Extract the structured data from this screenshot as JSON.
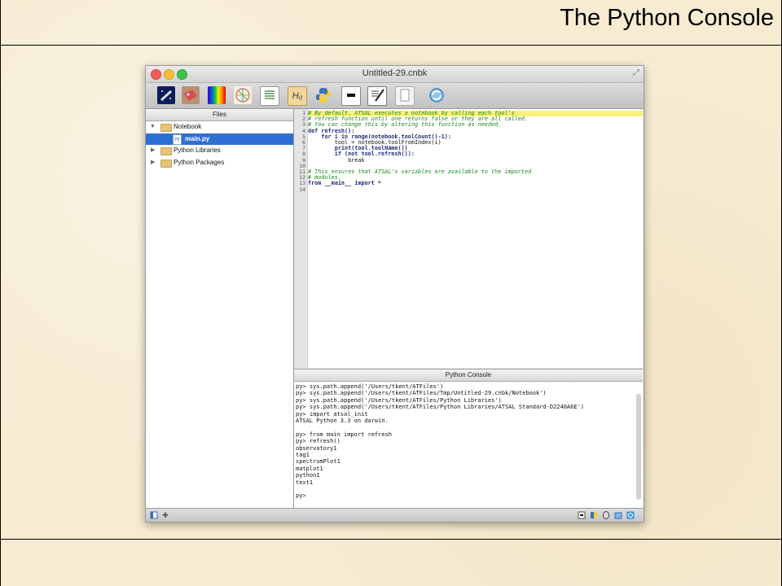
{
  "slide": {
    "title": "The Python Console"
  },
  "window": {
    "title": "Untitled-29.cnbk",
    "fullscreen_glyph": "⤢"
  },
  "toolbar": {
    "h0_label": "H₀",
    "icons": [
      "observatory-icon",
      "tag-icon",
      "spectrum-plot-icon",
      "matplot-icon",
      "text-icon",
      "heading-icon",
      "python-icon",
      "terminal-icon",
      "notebook-edit-icon",
      "document-icon",
      "refresh-icon"
    ]
  },
  "files_panel": {
    "header": "Files",
    "items": [
      {
        "label": "Notebook",
        "type": "folder",
        "expanded": true
      },
      {
        "label": "main.py",
        "type": "file",
        "selected": true
      },
      {
        "label": "Python Libraries",
        "type": "folder",
        "expanded": false
      },
      {
        "label": "Python Packages",
        "type": "folder",
        "expanded": false
      }
    ]
  },
  "editor": {
    "line_numbers": [
      "1",
      "2",
      "3",
      "4",
      "5",
      "6",
      "7",
      "8",
      "9",
      "10",
      "11",
      "12",
      "13",
      "14"
    ],
    "lines": [
      {
        "text": "# By default, ATSAL executes a notebook by calling each tool's",
        "kind": "comment",
        "highlight": true
      },
      {
        "text": "# refresh function until one returns false or they are all called.",
        "kind": "comment"
      },
      {
        "text": "# You can change this by altering this function as needed.",
        "kind": "comment"
      },
      {
        "text": "def refresh():",
        "kind": "code"
      },
      {
        "text": "    for i in range(notebook.toolCount()-1):",
        "kind": "code"
      },
      {
        "text": "        tool = notebook.toolFromIndex(i)",
        "kind": "plain"
      },
      {
        "text": "        print(tool.toolName())",
        "kind": "code"
      },
      {
        "text": "        if (not tool.refresh()):",
        "kind": "code"
      },
      {
        "text": "            break",
        "kind": "plain"
      },
      {
        "text": "",
        "kind": "plain"
      },
      {
        "text": "# This ensures that ATSAL's variables are available to the imported",
        "kind": "comment"
      },
      {
        "text": "# modules.",
        "kind": "comment"
      },
      {
        "text": "from __main__ import *",
        "kind": "code"
      },
      {
        "text": "",
        "kind": "plain"
      }
    ]
  },
  "console": {
    "header": "Python Console",
    "lines": [
      "py> sys.path.append('/Users/tkent/ATFiles')",
      "py> sys.path.append('/Users/tkent/ATFiles/Tmp/Untitled-29.cnbk/Notebook')",
      "py> sys.path.append('/Users/tkent/ATFiles/Python Libraries')",
      "py> sys.path.append('/Users/tkent/ATFiles/Python Libraries/ATSAL Standard-D2240A6E')",
      "py> import atsal_init",
      "ATSAL Python 3.3 on darwin.",
      "",
      "py> from main import refresh",
      "py> refresh()",
      "observatory1",
      "tag1",
      "spectrumPlot1",
      "matplot1",
      "python1",
      "text1",
      "",
      "py>"
    ]
  },
  "statusbar": {
    "add_glyph": "✚"
  }
}
